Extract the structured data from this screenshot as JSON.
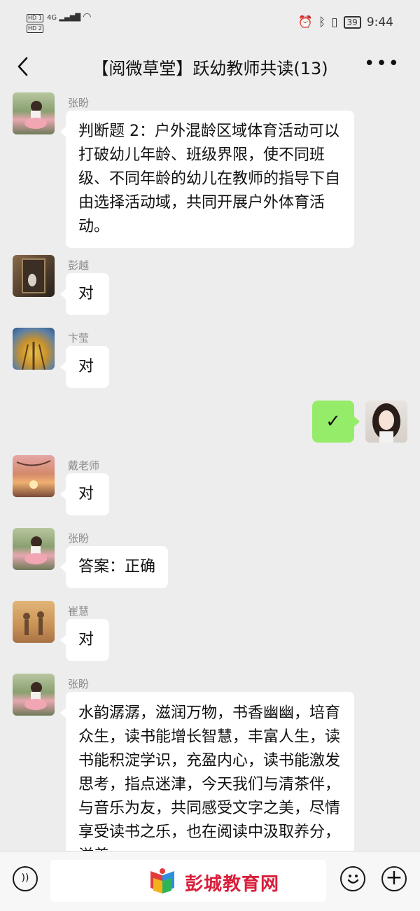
{
  "status_bar": {
    "sim1": "HD 1",
    "sim2": "HD 2",
    "network": "4G",
    "battery": "39",
    "time": "9:44"
  },
  "header": {
    "title": "【阅微草堂】跃幼教师共读(13)",
    "back_icon": "chevron-left-icon",
    "more_icon": "more-horizontal-icon"
  },
  "messages": [
    {
      "sender": "张盼",
      "text": "判断题 2：户外混龄区域体育活动可以打破幼儿年龄、班级界限，使不同班级、不同年龄的幼儿在教师的指导下自由选择活动域，共同开展户外体育活动。"
    },
    {
      "sender": "彭越",
      "text": "对"
    },
    {
      "sender": "卞莹",
      "text": "对"
    },
    {
      "sender": "",
      "text": "✓",
      "self": true
    },
    {
      "sender": "戴老师",
      "text": "对"
    },
    {
      "sender": "张盼",
      "text": "答案：正确"
    },
    {
      "sender": "崔慧",
      "text": "对"
    },
    {
      "sender": "张盼",
      "text": "水韵潺潺，滋润万物，书香幽幽，培育众生，读书能增长智慧，丰富人生，读书能积淀学识，充盈内心，读书能激发思考，指点迷津，今天我们与清茶伴，与音乐为友，共同感受文字之美，尽情享受读书之乐，也在阅读中汲取养分，滋养"
    }
  ],
  "bottom_bar": {
    "voice_icon": "voice-icon",
    "emoji_icon": "emoji-icon",
    "plus_icon": "plus-icon",
    "watermark": "彭城教育网",
    "watermark_logo": "book-logo-icon"
  },
  "colors": {
    "background": "#ededed",
    "self_bubble": "#95ec69",
    "bubble": "#ffffff",
    "watermark": "#d81e3a"
  }
}
